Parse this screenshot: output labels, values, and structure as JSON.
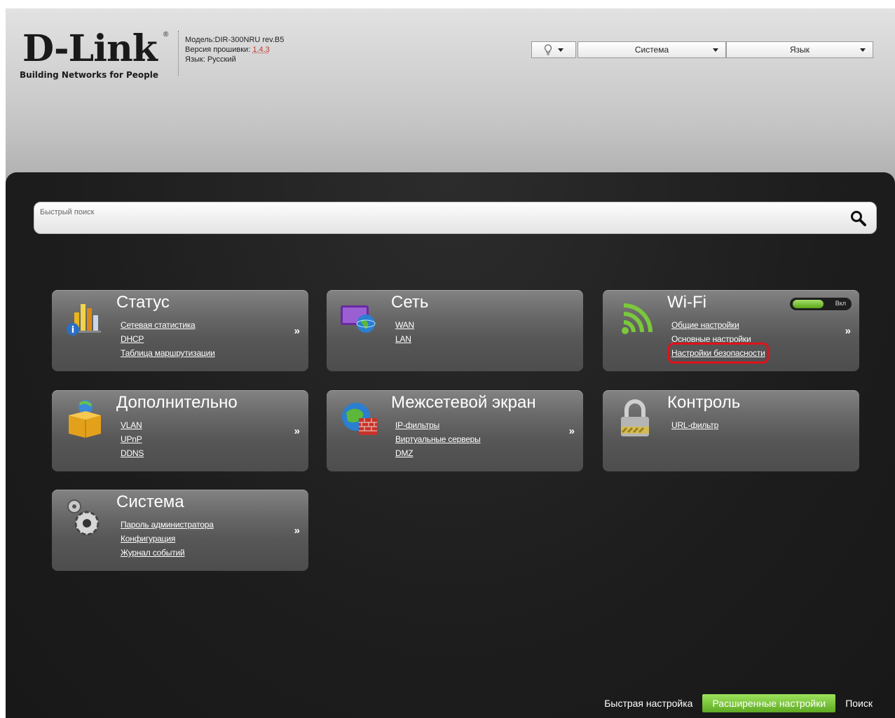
{
  "header": {
    "logo_text": "D-Link",
    "logo_reg": "®",
    "logo_tagline": "Building Networks for People",
    "model_line": "Модель:DIR-300NRU rev.B5",
    "firmware_prefix": "Версия прошивки: ",
    "firmware_version": "1.4.3",
    "language_line": "Язык: Русский",
    "bulb_icon": "lightbulb-icon",
    "system_menu": "Система",
    "language_menu": "Язык"
  },
  "search": {
    "placeholder": "Быстрый поиск",
    "icon": "magnifier-icon"
  },
  "cards": {
    "status": {
      "title": "Статус",
      "links": [
        "Сетевая статистика",
        "DHCP",
        "Таблица маршрутизации"
      ],
      "more": "»"
    },
    "network": {
      "title": "Сеть",
      "links": [
        "WAN",
        "LAN"
      ]
    },
    "wifi": {
      "title": "Wi-Fi",
      "links": [
        "Общие настройки",
        "Основные настройки",
        "Настройки безопасности"
      ],
      "toggle_label": "Вкл",
      "toggle_on": true,
      "more": "»",
      "highlighted_link": "Настройки безопасности"
    },
    "extra": {
      "title": "Дополнительно",
      "links": [
        "VLAN",
        "UPnP",
        "DDNS"
      ],
      "more": "»"
    },
    "firewall": {
      "title": "Межсетевой экран",
      "links": [
        "IP-фильтры",
        "Виртуальные серверы",
        "DMZ"
      ],
      "more": "»"
    },
    "control": {
      "title": "Контроль",
      "links": [
        "URL-фильтр"
      ]
    },
    "system": {
      "title": "Система",
      "links": [
        "Пароль администратора",
        "Конфигурация",
        "Журнал событий"
      ],
      "more": "»"
    }
  },
  "footer": {
    "quick_setup": "Быстрая настройка",
    "advanced_setup": "Расширенные настройки",
    "search": "Поиск"
  },
  "colors": {
    "accent_green": "#7cc73c",
    "highlight_red": "#e0121a",
    "firmware_red": "#c0392b"
  }
}
